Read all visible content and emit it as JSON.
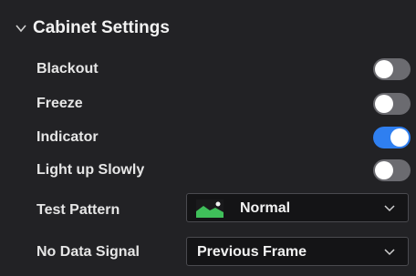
{
  "panel": {
    "title": "Cabinet Settings",
    "expanded": true
  },
  "toggles": [
    {
      "label": "Blackout",
      "on": false
    },
    {
      "label": "Freeze",
      "on": false
    },
    {
      "label": "Indicator",
      "on": true
    },
    {
      "label": "Light up Slowly",
      "on": false
    }
  ],
  "test_pattern": {
    "label": "Test Pattern",
    "value": "Normal",
    "thumbnail_icon": "landscape-image-icon"
  },
  "no_data_signal": {
    "label": "No Data Signal",
    "value": "Previous Frame"
  },
  "colors": {
    "toggle_on": "#2f7ff0",
    "toggle_off": "#6b6b70",
    "background": "#222225"
  }
}
